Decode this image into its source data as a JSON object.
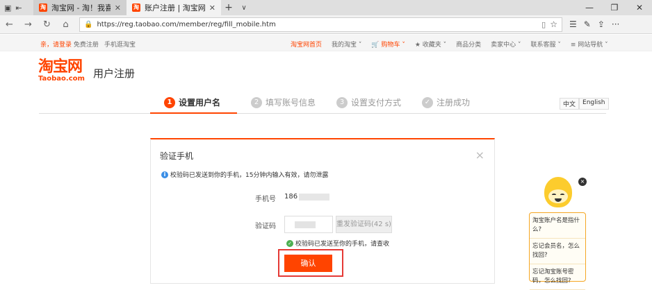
{
  "browser": {
    "tabs": [
      {
        "title": "淘宝网 - 淘！我喜欢",
        "favicon": "淘",
        "active": false
      },
      {
        "title": "账户注册 | 淘宝网",
        "favicon": "淘",
        "active": true
      }
    ],
    "url": "https://reg.taobao.com/member/reg/fill_mobile.htm"
  },
  "topbar": {
    "greeting": "亲，请登录",
    "register": "免费注册",
    "mobile": "手机逛淘宝",
    "nav": [
      "淘宝网首页",
      "我的淘宝 ˅",
      "🛒 购物车 ˅",
      "★ 收藏夹 ˅",
      "商品分类",
      "卖家中心 ˅",
      "联系客服 ˅",
      "≡ 网站导航 ˅"
    ]
  },
  "header": {
    "logo_cn": "淘宝网",
    "logo_en": "Taobao.com",
    "heading": "用户注册"
  },
  "steps": [
    {
      "num": "1",
      "label": "设置用户名",
      "active": true
    },
    {
      "num": "2",
      "label": "填写账号信息",
      "active": false
    },
    {
      "num": "3",
      "label": "设置支付方式",
      "active": false
    },
    {
      "num": "✓",
      "label": "注册成功",
      "active": false
    }
  ],
  "lang": {
    "zh": "中文",
    "en": "English"
  },
  "dialog": {
    "title": "验证手机",
    "close": "×",
    "notice": "校验码已发送到你的手机，15分钟内输入有效，请勿泄露",
    "phone_label": "手机号",
    "phone_value": "186",
    "code_label": "验证码",
    "resend": "重发验证码(42 s)",
    "sent_msg": "校验码已发送至你的手机，请查收",
    "confirm": "确认"
  },
  "help": {
    "close": "×",
    "items": [
      "淘宝账户名是指什么?",
      "忘记会员名，怎么找回?",
      "忘记淘宝账号密码，怎么找回?"
    ]
  },
  "colors": {
    "brand": "#ff4400",
    "highlight": "#e53935"
  }
}
